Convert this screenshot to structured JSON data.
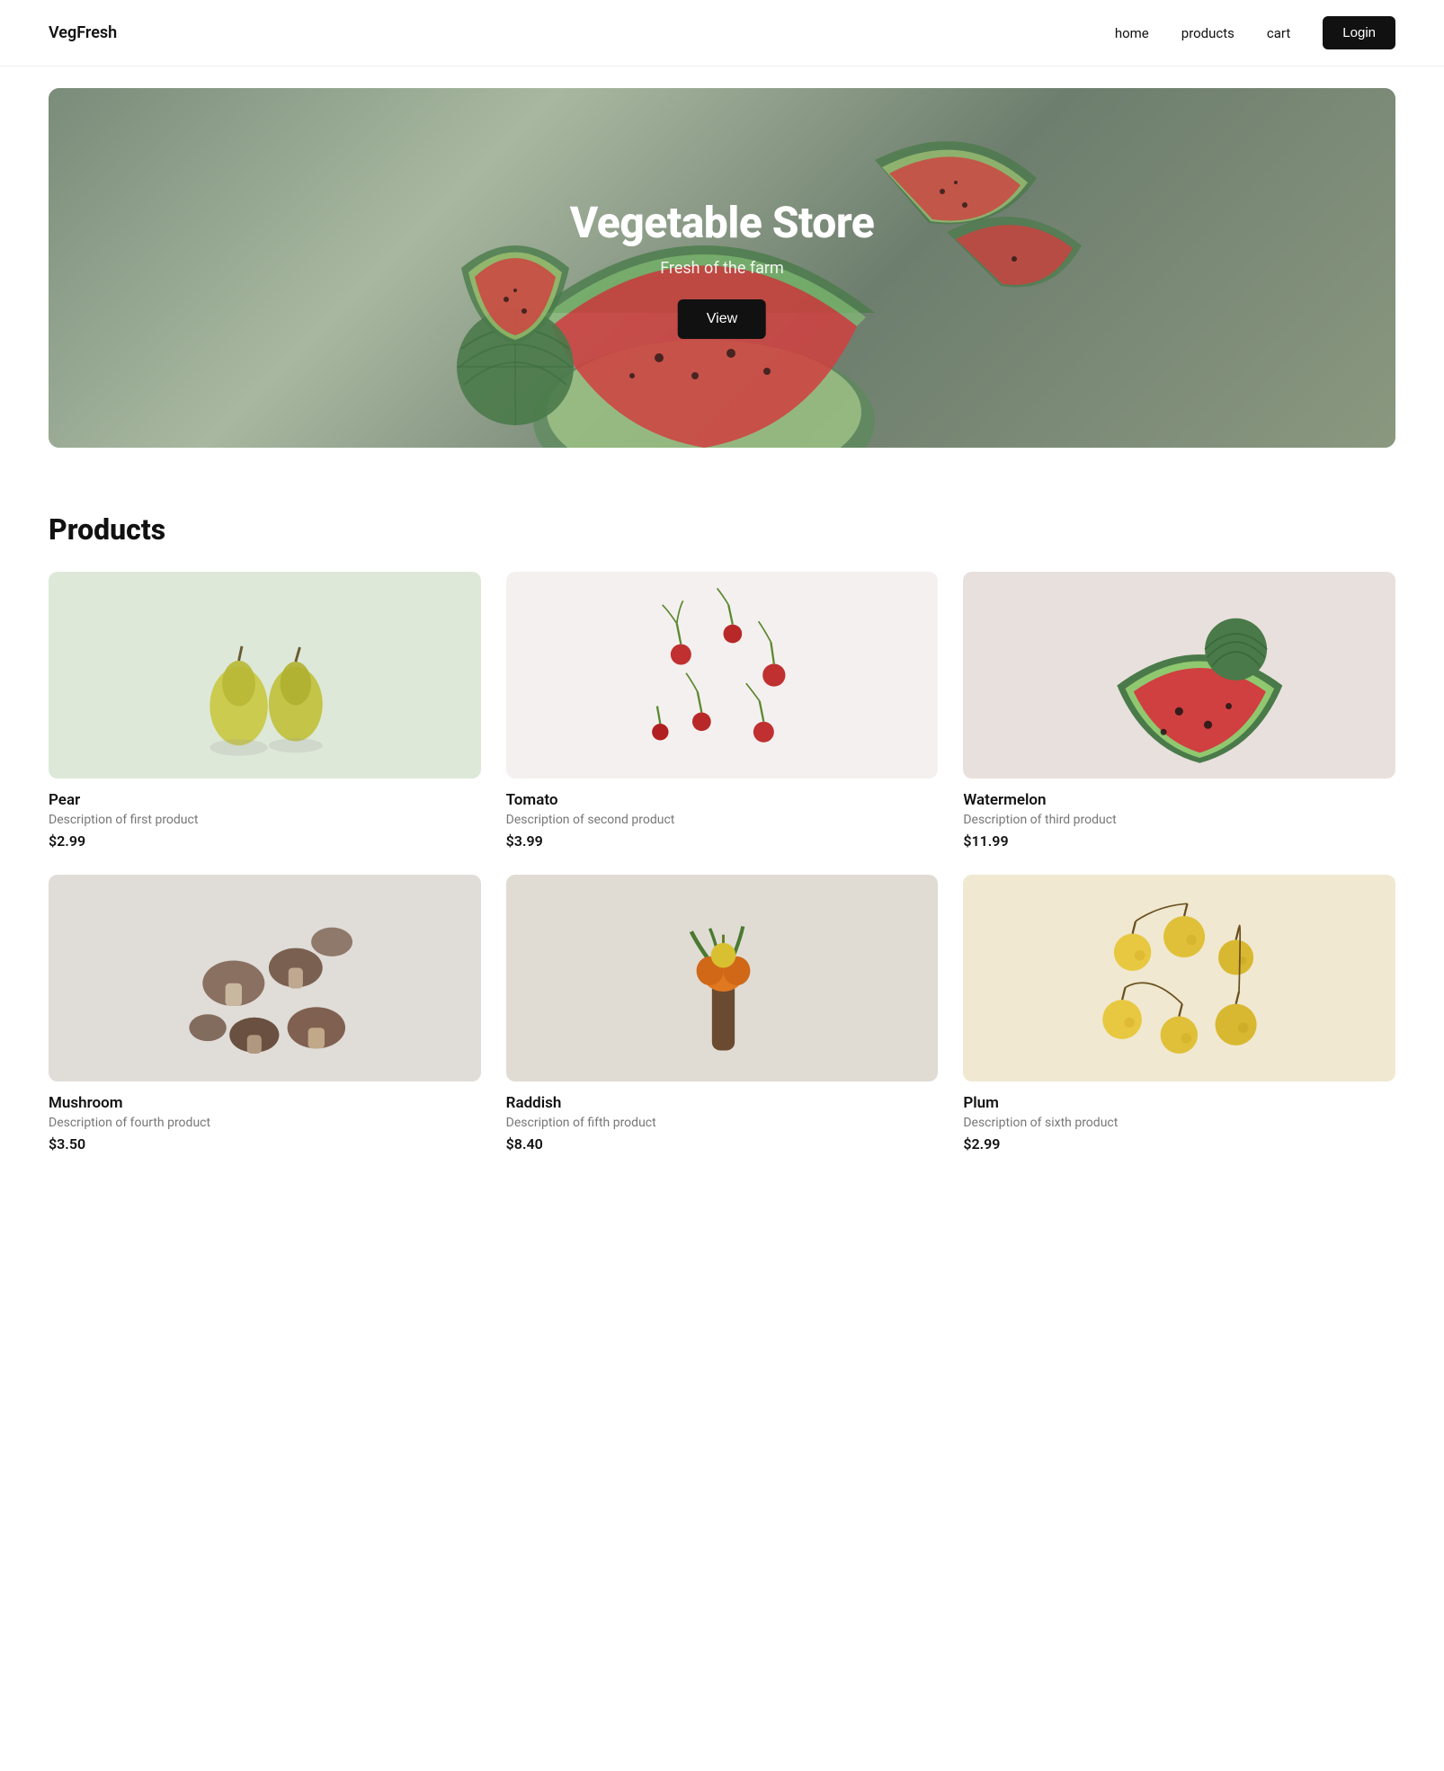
{
  "brand": "VegFresh",
  "nav": {
    "links": [
      {
        "id": "home",
        "label": "home"
      },
      {
        "id": "products",
        "label": "products"
      },
      {
        "id": "cart",
        "label": "cart"
      }
    ],
    "login_label": "Login"
  },
  "hero": {
    "title": "Vegetable Store",
    "subtitle": "Fresh of the farm",
    "button_label": "View"
  },
  "products_section": {
    "title": "Products",
    "items": [
      {
        "id": "pear",
        "name": "Pear",
        "description": "Description of first product",
        "price": "$2.99",
        "emoji": "🍐",
        "bg_class": "bg-pear"
      },
      {
        "id": "tomato",
        "name": "Tomato",
        "description": "Description of second product",
        "price": "$3.99",
        "emoji": "🌿",
        "bg_class": "bg-tomato"
      },
      {
        "id": "watermelon",
        "name": "Watermelon",
        "description": "Description of third product",
        "price": "$11.99",
        "emoji": "🍉",
        "bg_class": "bg-watermelon"
      },
      {
        "id": "mushroom",
        "name": "Mushroom",
        "description": "Description of fourth product",
        "price": "$3.50",
        "emoji": "🍄",
        "bg_class": "bg-mushroom"
      },
      {
        "id": "raddish",
        "name": "Raddish",
        "description": "Description of fifth product",
        "price": "$8.40",
        "emoji": "🥕",
        "bg_class": "bg-raddish"
      },
      {
        "id": "plum",
        "name": "Plum",
        "description": "Description of sixth product",
        "price": "$2.99",
        "emoji": "🍒",
        "bg_class": "bg-plum"
      }
    ]
  }
}
